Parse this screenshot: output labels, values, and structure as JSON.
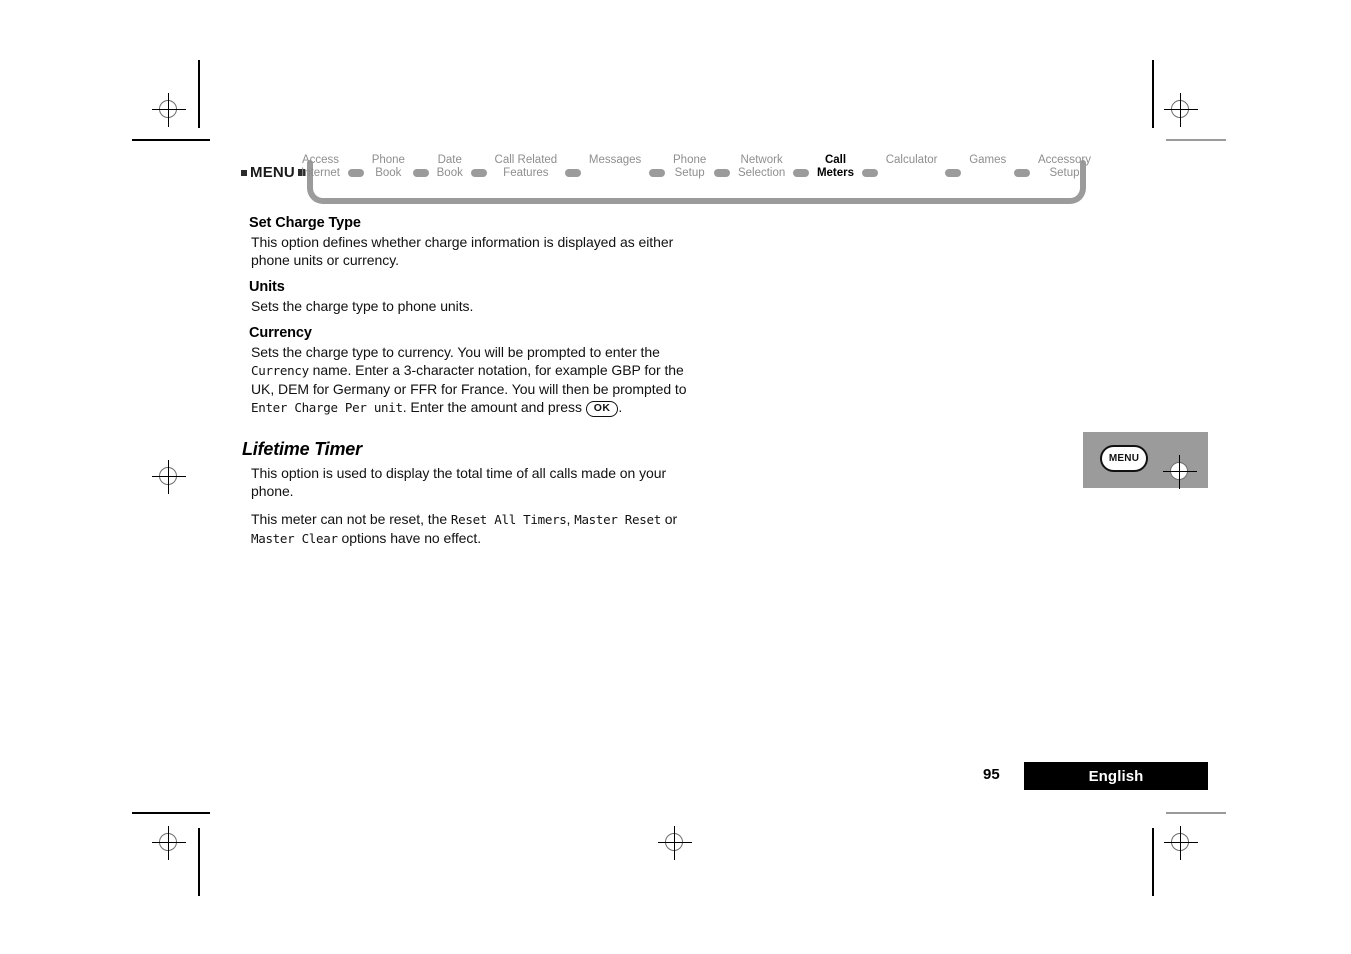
{
  "nav": {
    "menu_label": "MENU",
    "items": [
      {
        "label": "Access\nInternet",
        "active": false
      },
      {
        "label": "Phone\nBook",
        "active": false
      },
      {
        "label": "Date\nBook",
        "active": false
      },
      {
        "label": "Call Related\nFeatures",
        "active": false
      },
      {
        "label": "Messages",
        "active": false
      },
      {
        "label": "Phone\nSetup",
        "active": false
      },
      {
        "label": "Network\nSelection",
        "active": false
      },
      {
        "label": "Call\nMeters",
        "active": true
      },
      {
        "label": "Calculator",
        "active": false
      },
      {
        "label": "Games",
        "active": false
      },
      {
        "label": "Accessory\nSetup",
        "active": false
      }
    ]
  },
  "content": {
    "set_charge_type": {
      "heading": "Set Charge Type",
      "paragraph": "This option defines whether charge information is displayed as either phone units or currency."
    },
    "units": {
      "heading": "Units",
      "paragraph": "Sets the charge type to phone units."
    },
    "currency": {
      "heading": "Currency",
      "part1": "Sets the charge type to currency. You will be prompted to enter the ",
      "lcd1": "Currency",
      "part2": " name. Enter a 3-character notation, for example GBP for the UK, DEM for Germany or FFR for France. You will then be prompted to ",
      "lcd2": "Enter Charge Per unit",
      "part3": ". Enter the amount and press ",
      "ok_key": "OK",
      "part4": "."
    },
    "lifetime_timer": {
      "heading": "Lifetime Timer",
      "paragraph1": "This option is used to display the total time of all calls made on your phone.",
      "p2_part1": "This meter can not be reset, the ",
      "p2_lcd1": "Reset All Timers",
      "p2_part2": ", ",
      "p2_lcd2": "Master Reset",
      "p2_part3": " or ",
      "p2_lcd3": "Master Clear",
      "p2_part4": " options have no effect."
    }
  },
  "margin_figure": {
    "key_label": "MENU"
  },
  "footer": {
    "page_number": "95",
    "language": "English"
  },
  "colors": {
    "nav_gray": "#9b9b9b",
    "active_text": "#000000",
    "inactive_text": "#8e8e8e",
    "figure_bg": "#9b9b9b",
    "footer_bar": "#000000"
  }
}
